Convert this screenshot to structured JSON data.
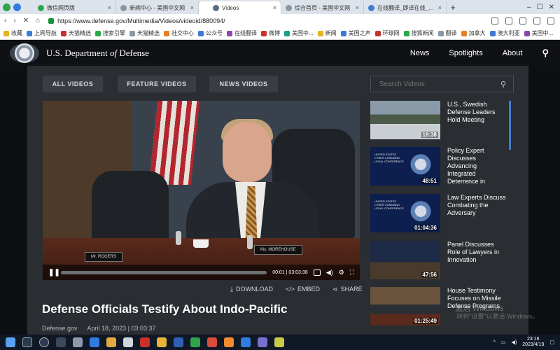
{
  "browser": {
    "tabs": [
      {
        "title": "微信网页版",
        "active": false
      },
      {
        "title": "新闻中心 - 美国中文网",
        "active": false
      },
      {
        "title": "Videos",
        "active": true
      },
      {
        "title": "综合首页 - 美国中文网",
        "active": false
      },
      {
        "title": "在线翻译_即译在线_金山词霸",
        "active": false
      }
    ],
    "new_tab": "+",
    "url": "https://www.defense.gov/Multimedia/Videos/videoid/880094/",
    "bookmarks": [
      "收藏",
      "上网导航",
      "天猫精选",
      "搜索引擎",
      "天猫精选",
      "社交中心",
      "公众号",
      "在线翻译",
      "微博",
      "美国中...",
      "新闻",
      "美国之声",
      "环球网",
      "搜狐新闻",
      "翻译",
      "加拿大",
      "澳大利亚",
      "美国中..."
    ]
  },
  "site": {
    "department_prefix": "U.S. Department",
    "department_of": "of",
    "department_suffix": "Defense",
    "nav": [
      "News",
      "Spotlights",
      "About"
    ]
  },
  "filters": [
    "ALL VIDEOS",
    "FEATURE VIDEOS",
    "NEWS VIDEOS"
  ],
  "search": {
    "placeholder": "Search Videos"
  },
  "player": {
    "nameplate_left": "Mr. ROGERS",
    "nameplate_right": "Ms. MOREHOUSE",
    "time": "00:01 | 03:03:38",
    "progress": 0.0
  },
  "share": {
    "download": "DOWNLOAD",
    "embed": "EMBED",
    "share": "SHARE"
  },
  "video": {
    "title": "Defense Officials Testify About Indo-Pacific",
    "source": "Defense.gov",
    "date": "April 18, 2023 | 03:03:37"
  },
  "related": [
    {
      "title": "U.S., Swedish Defense Leaders Hold Meeting",
      "duration": "18:38"
    },
    {
      "title": "Policy Expert Discusses Advancing Integrated Deterrence in Cyberspace",
      "duration": "48:51",
      "thumb_text": "UNITED STATES CYBER COMMAND LEGAL CONFERENCE"
    },
    {
      "title": "Law Experts Discuss Combating the Adversary",
      "duration": "01:04:36",
      "thumb_text": "UNITED STATES CYBER COMMAND LEGAL CONFERENCE"
    },
    {
      "title": "Panel Discusses Role of Lawyers in Innovation",
      "duration": "47:56"
    },
    {
      "title": "House Testimony Focuses on Missile Defense Programs",
      "duration": "01:25:49"
    }
  ],
  "watermark": {
    "line1": "激活 Windows",
    "line2": "转到\"设置\"以激活 Windows。"
  },
  "taskbar": {
    "time": "23:16",
    "date": "2023/4/19"
  }
}
